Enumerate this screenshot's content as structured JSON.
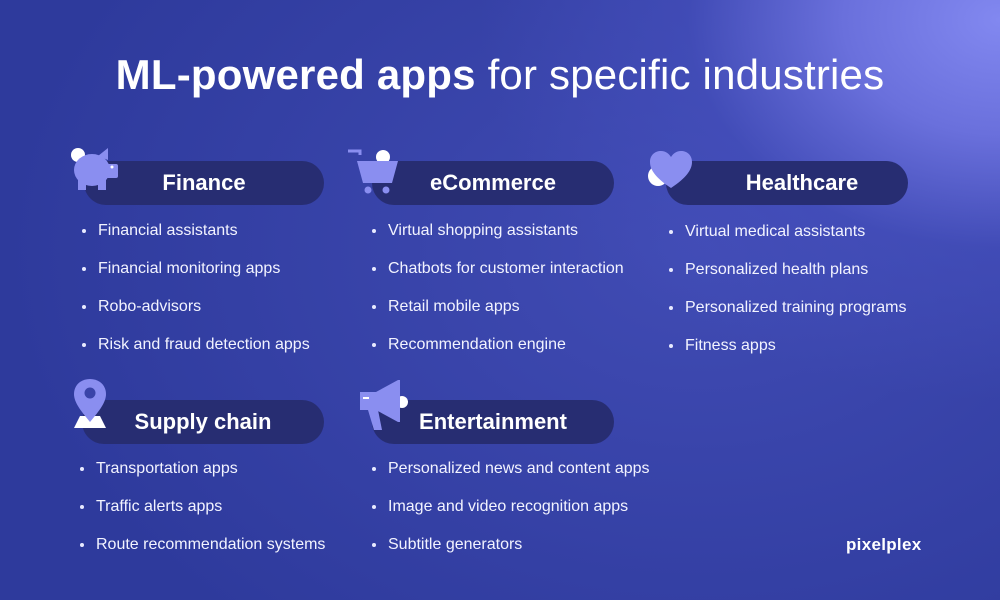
{
  "title": {
    "bold": "ML-powered apps",
    "light": "for specific industries"
  },
  "colors": {
    "background": "#2e3a9c",
    "glow": "#8288f0",
    "pill": "#272d72",
    "icon": "#8a8ef0",
    "text": "#ffffff"
  },
  "industries": [
    {
      "name": "Finance",
      "icon": "piggy-bank-icon",
      "items": [
        "Financial assistants",
        "Financial monitoring apps",
        "Robo-advisors",
        "Risk and fraud detection apps"
      ]
    },
    {
      "name": "eCommerce",
      "icon": "shopping-cart-icon",
      "items": [
        "Virtual shopping assistants",
        "Chatbots for customer interaction",
        "Retail mobile apps",
        "Recommendation engine"
      ]
    },
    {
      "name": "Healthcare",
      "icon": "heart-icon",
      "items": [
        "Virtual medical assistants",
        "Personalized health plans",
        "Personalized training programs",
        "Fitness apps"
      ]
    },
    {
      "name": "Supply chain",
      "icon": "map-pin-icon",
      "items": [
        "Transportation apps",
        "Traffic alerts apps",
        "Route recommendation systems"
      ]
    },
    {
      "name": "Entertainment",
      "icon": "megaphone-icon",
      "items": [
        "Personalized news and content apps",
        "Image and video recognition apps",
        "Subtitle generators"
      ]
    }
  ],
  "brand": "pixelplex"
}
